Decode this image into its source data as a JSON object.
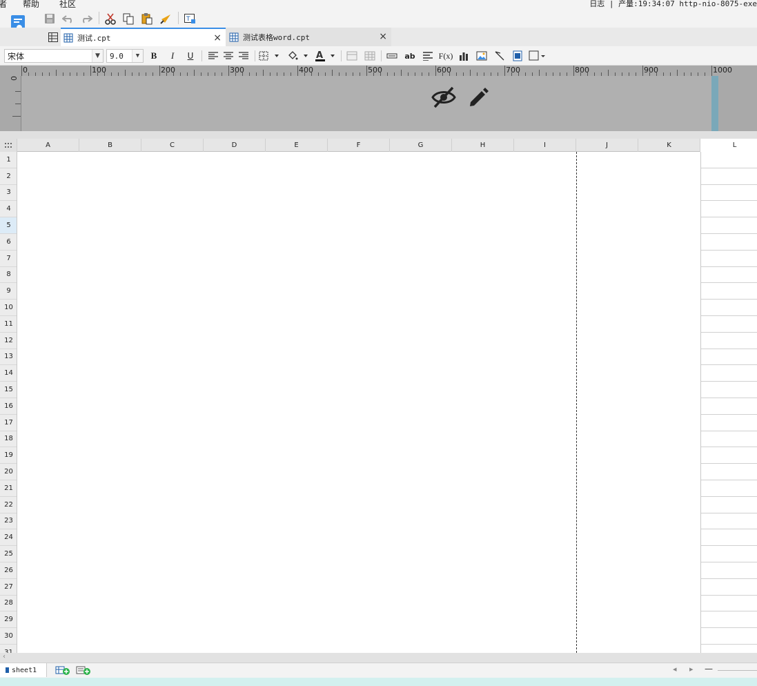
{
  "menu": {
    "left_partial": "者",
    "help": "帮助",
    "community": "社区",
    "right_status": "日志 | 产量:19:34:07 http-nio-8075-exe"
  },
  "tabs": [
    {
      "label": "测试.cpt",
      "active": true
    },
    {
      "label": "测试表格word.cpt",
      "active": false
    }
  ],
  "format": {
    "font_family": "宋体",
    "font_size": "9.0",
    "bold": "B",
    "italic": "I",
    "underline": "U",
    "text_sample": "ab",
    "formula": "F(x)"
  },
  "ruler": {
    "labels": [
      "0",
      "100",
      "200",
      "300",
      "400",
      "500",
      "600",
      "700",
      "800",
      "900",
      "1000"
    ],
    "left_label": "0"
  },
  "grid": {
    "columns": [
      "A",
      "B",
      "C",
      "D",
      "E",
      "F",
      "G",
      "H",
      "I",
      "J",
      "K",
      "L"
    ],
    "rows": [
      "1",
      "2",
      "3",
      "4",
      "5",
      "6",
      "7",
      "8",
      "9",
      "10",
      "11",
      "12",
      "13",
      "14",
      "15",
      "16",
      "17",
      "18",
      "19",
      "20",
      "21",
      "22",
      "23",
      "24",
      "25",
      "26",
      "27",
      "28",
      "29",
      "30",
      "31"
    ],
    "selected_row": "5"
  },
  "sheets": [
    {
      "label": "sheet1"
    }
  ],
  "colors": {
    "accent": "#3a8ee6",
    "header_marker": "#7aa8b9",
    "statusbar": "#d3f0ef"
  }
}
